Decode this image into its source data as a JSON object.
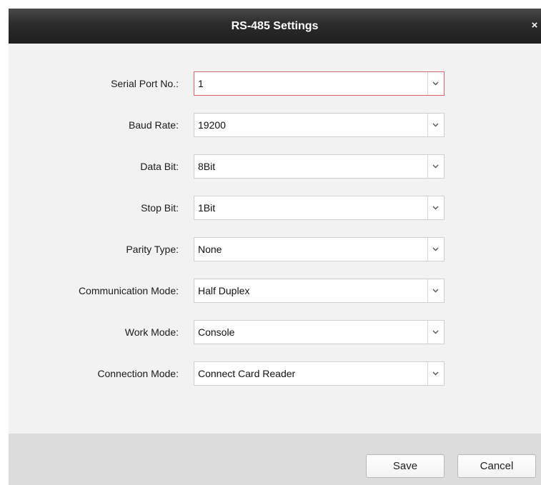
{
  "dialog": {
    "title": "RS-485 Settings",
    "close_glyph": "×"
  },
  "fields": [
    {
      "label": "Serial Port No.:",
      "value": "1",
      "focused": true
    },
    {
      "label": "Baud Rate:",
      "value": "19200"
    },
    {
      "label": "Data Bit:",
      "value": "8Bit"
    },
    {
      "label": "Stop Bit:",
      "value": "1Bit"
    },
    {
      "label": "Parity Type:",
      "value": "None"
    },
    {
      "label": "Communication Mode:",
      "value": "Half Duplex"
    },
    {
      "label": "Work Mode:",
      "value": "Console"
    },
    {
      "label": "Connection Mode:",
      "value": "Connect Card Reader"
    }
  ],
  "footer": {
    "save_label": "Save",
    "cancel_label": "Cancel"
  },
  "colors": {
    "titlebar": "#2b2b2b",
    "focus_border": "#e0636c",
    "form_background": "#f2f2f2",
    "footer_background": "#dcdcdc"
  },
  "icons": {
    "dropdown": "chevron-down-icon",
    "close": "close-icon"
  }
}
